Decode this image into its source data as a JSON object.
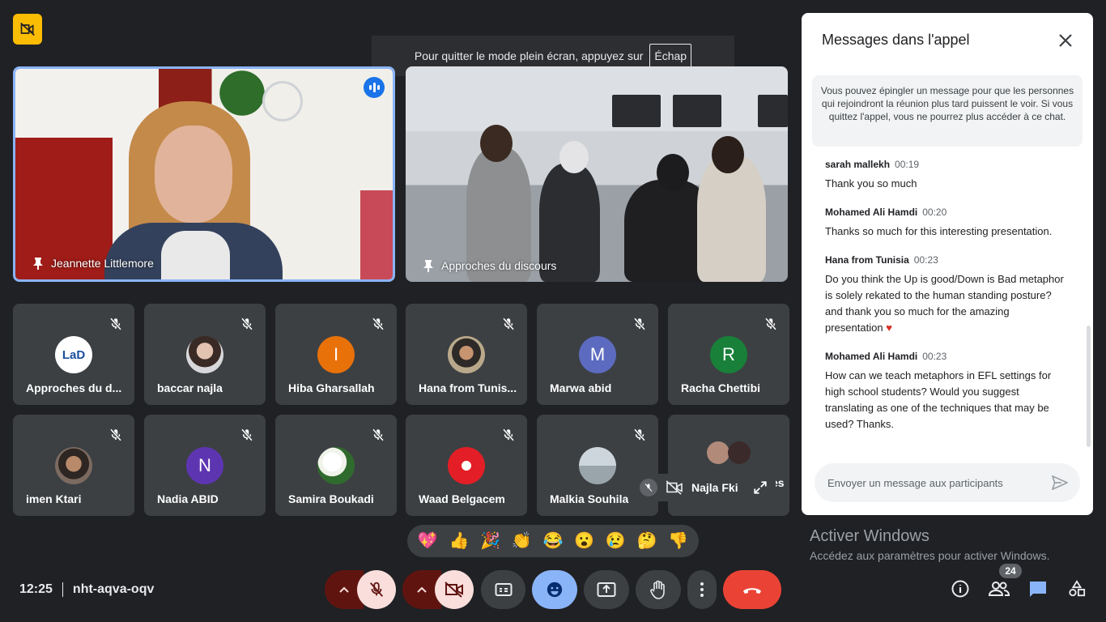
{
  "banner": {
    "text": "Pour quitter le mode plein écran, appuyez sur",
    "key": "Échap"
  },
  "main_tiles": [
    {
      "name": "Jeannette Littlemore"
    },
    {
      "name": "Approches du discours"
    }
  ],
  "participants": [
    {
      "name": "Approches du d...",
      "avatar_type": "logo",
      "avatar_text": "LaD"
    },
    {
      "name": "baccar najla",
      "avatar_type": "photo"
    },
    {
      "name": "Hiba Gharsallah",
      "avatar_type": "letter",
      "letter": "I",
      "color": "#e8710a"
    },
    {
      "name": "Hana from Tunis...",
      "avatar_type": "photo"
    },
    {
      "name": "Marwa abid",
      "avatar_type": "letter",
      "letter": "M",
      "color": "#5c6bc0"
    },
    {
      "name": "Racha Chettibi",
      "avatar_type": "letter",
      "letter": "R",
      "color": "#188038"
    },
    {
      "name": "imen Ktari",
      "avatar_type": "photo"
    },
    {
      "name": "Nadia ABID",
      "avatar_type": "letter",
      "letter": "N",
      "color": "#5e35b1"
    },
    {
      "name": "Samira Boukadi",
      "avatar_type": "photo"
    },
    {
      "name": "Waad Belgacem",
      "avatar_type": "photo"
    },
    {
      "name": "Malkia Souhila",
      "avatar_type": "photo"
    },
    {
      "name": "es",
      "avatar_type": "group"
    }
  ],
  "self_view": {
    "name": "Najla Fki"
  },
  "reactions": [
    "💖",
    "👍",
    "🎉",
    "👏",
    "😂",
    "😮",
    "😢",
    "🤔",
    "👎"
  ],
  "meeting": {
    "time": "12:25",
    "code": "nht-aqva-oqv"
  },
  "people_count": "24",
  "windows_notice": {
    "title": "Activer Windows",
    "subtitle": "Accédez aux paramètres pour activer Windows."
  },
  "chat": {
    "title": "Messages dans l'appel",
    "notice": "Vous pouvez épingler un message pour que les personnes qui rejoindront la réunion plus tard puissent le voir. Si vous quittez l'appel, vous ne pourrez plus accéder à ce chat.",
    "messages": [
      {
        "author": "sarah mallekh",
        "time": "00:19",
        "text": "Thank you so much"
      },
      {
        "author": "Mohamed Ali Hamdi",
        "time": "00:20",
        "text": "Thanks so much for this interesting presentation."
      },
      {
        "author": "Hana from Tunisia",
        "time": "00:23",
        "text": "Do you think the Up is good/Down is Bad metaphor is solely rekated to the human standing posture? and thank you so much for the amazing presentation",
        "emoji": "♥"
      },
      {
        "author": "Mohamed Ali Hamdi",
        "time": "00:23",
        "text": "How can we teach metaphors in EFL settings for high school students? Would you suggest translating as one of the techniques that may be used? Thanks."
      }
    ],
    "input_placeholder": "Envoyer un message aux participants"
  },
  "colors": {
    "accent_blue": "#8ab4f8",
    "end_call_red": "#ea4335",
    "bg": "#202124",
    "tile": "#3c4043"
  }
}
